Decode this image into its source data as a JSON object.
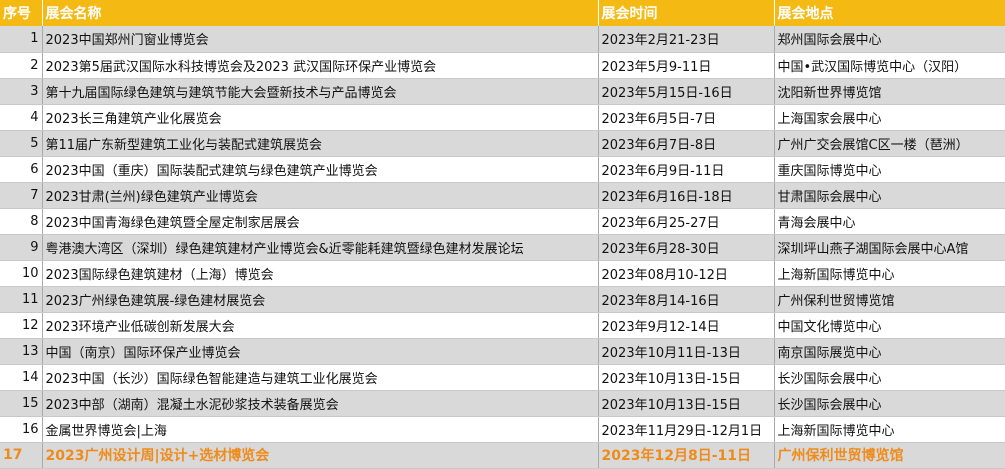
{
  "header": {
    "no": "序号",
    "name": "展会名称",
    "time": "展会时间",
    "place": "展会地点"
  },
  "rows": [
    {
      "no": "1",
      "name": "2023中国郑州门窗业博览会",
      "time": "2023年2月21-23日",
      "place": "郑州国际会展中心"
    },
    {
      "no": "2",
      "name": "2023第5届武汉国际水科技博览会及2023 武汉国际环保产业博览会",
      "time": "2023年5月9-11日",
      "place": "中国•武汉国际博览中心（汉阳）"
    },
    {
      "no": "3",
      "name": "第十九届国际绿色建筑与建筑节能大会暨新技术与产品博览会",
      "time": "2023年5月15日-16日",
      "place": "沈阳新世界博览馆"
    },
    {
      "no": "4",
      "name": "2023长三角建筑产业化展览会",
      "time": "2023年6月5日-7日",
      "place": "上海国家会展中心"
    },
    {
      "no": "5",
      "name": "第11届广东新型建筑工业化与装配式建筑展览会",
      "time": "2023年6月7日-8日",
      "place": "广州广交会展馆C区一楼（琶洲）"
    },
    {
      "no": "6",
      "name": "2023中国（重庆）国际装配式建筑与绿色建筑产业博览会",
      "time": "2023年6月9日-11日",
      "place": "重庆国际博览中心"
    },
    {
      "no": "7",
      "name": "2023甘肃(兰州)绿色建筑产业博览会",
      "time": "2023年6月16日-18日",
      "place": "甘肃国际会展中心"
    },
    {
      "no": "8",
      "name": "2023中国青海绿色建筑暨全屋定制家居展会",
      "time": "2023年6月25-27日",
      "place": "青海会展中心"
    },
    {
      "no": "9",
      "name": "粤港澳大湾区（深圳）绿色建筑建材产业博览会&近零能耗建筑暨绿色建材发展论坛",
      "time": "2023年6月28-30日",
      "place": "深圳坪山燕子湖国际会展中心A馆"
    },
    {
      "no": "10",
      "name": "2023国际绿色建筑建材（上海）博览会",
      "time": "2023年08月10-12日",
      "place": "上海新国际博览中心"
    },
    {
      "no": "11",
      "name": "2023广州绿色建筑展-绿色建材展览会",
      "time": "2023年8月14-16日",
      "place": "广州保利世贸博览馆"
    },
    {
      "no": "12",
      "name": "2023环境产业低碳创新发展大会",
      "time": "2023年9月12-14日",
      "place": "中国文化博览中心"
    },
    {
      "no": "13",
      "name": "中国（南京）国际环保产业博览会",
      "time": "2023年10月11日-13日",
      "place": "南京国际展览中心"
    },
    {
      "no": "14",
      "name": "2023中国（长沙）国际绿色智能建造与建筑工业化展览会",
      "time": "2023年10月13日-15日",
      "place": "长沙国际会展中心"
    },
    {
      "no": "15",
      "name": "2023中部（湖南）混凝土水泥砂浆技术装备展览会",
      "time": "2023年10月13日-15日",
      "place": "长沙国际会展中心"
    },
    {
      "no": "16",
      "name": "金属世界博览会|上海",
      "time": "2023年11月29日-12月1日",
      "place": "上海新国际博览中心"
    },
    {
      "no": "17",
      "name": "2023广州设计周|设计+选材博览会",
      "time": "2023年12月8日-11日",
      "place": "广州保利世贸博览馆"
    }
  ],
  "colors": {
    "header_bg": "#f5b914",
    "header_text": "#ffffff",
    "stripe": "#d9d9d9",
    "highlight_text": "#ee8b1a"
  }
}
